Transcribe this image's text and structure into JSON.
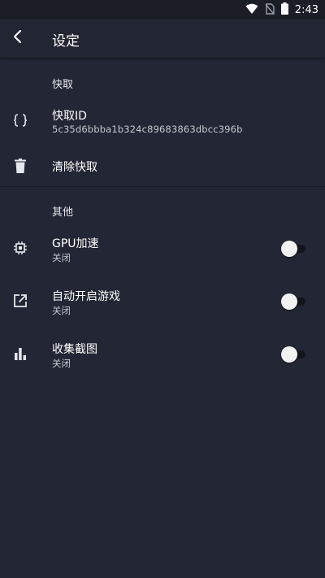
{
  "status_bar": {
    "time": "2:43",
    "icons": [
      "wifi-icon",
      "no-sim-icon",
      "battery-icon"
    ]
  },
  "app_bar": {
    "title": "设定",
    "back_icon": "back-arrow-icon"
  },
  "sections": {
    "snapshot": {
      "header": "快取",
      "id_item": {
        "title": "快取ID",
        "value": "5c35d6bbba1b324c89683863dbcc396b",
        "icon": "braces-icon"
      },
      "clear_item": {
        "title": "清除快取",
        "icon": "trash-icon"
      }
    },
    "other": {
      "header": "其他",
      "gpu_item": {
        "title": "GPU加速",
        "status": "关闭",
        "icon": "chip-icon",
        "enabled": false
      },
      "autostart_item": {
        "title": "自动开启游戏",
        "status": "关闭",
        "icon": "open-external-icon",
        "enabled": false
      },
      "screenshot_item": {
        "title": "收集截图",
        "status": "关闭",
        "icon": "bar-chart-icon",
        "enabled": false
      }
    }
  },
  "colors": {
    "background": "#232634",
    "status_bar": "#1b1d27",
    "switch_thumb_off": "#f2f2f2",
    "switch_track_off": "#14151c"
  }
}
